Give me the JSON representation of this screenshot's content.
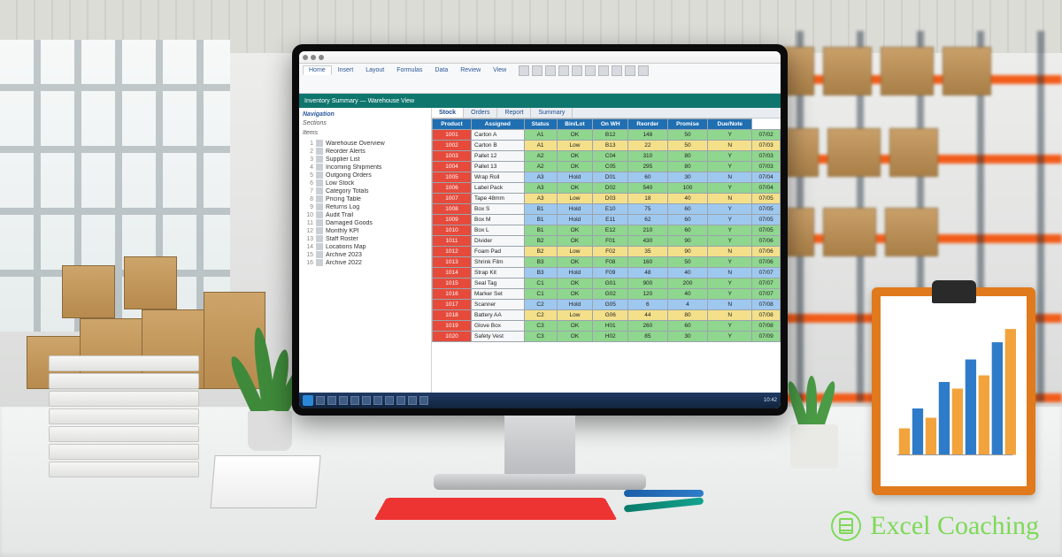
{
  "brand": {
    "name": "Excel Coaching"
  },
  "app": {
    "workband_title": "Inventory Summary — Warehouse View",
    "tabs": [
      {
        "label": "Home"
      },
      {
        "label": "Insert"
      },
      {
        "label": "Layout"
      },
      {
        "label": "Formulas"
      },
      {
        "label": "Data"
      },
      {
        "label": "Review"
      },
      {
        "label": "View"
      }
    ],
    "sheet_tabs": [
      {
        "label": "Stock"
      },
      {
        "label": "Orders"
      },
      {
        "label": "Report"
      },
      {
        "label": "Summary"
      }
    ]
  },
  "sidebar": {
    "header": "Navigation",
    "field_label": "Sections",
    "subheader": "Items",
    "items": [
      "Warehouse Overview",
      "Reorder Alerts",
      "Supplier List",
      "Incoming Shipments",
      "Outgoing Orders",
      "Low Stock",
      "Category Totals",
      "Pricing Table",
      "Returns Log",
      "Audit Trail",
      "Damaged Goods",
      "Monthly KPI",
      "Staff Roster",
      "Locations Map",
      "Archive 2023",
      "Archive 2022"
    ]
  },
  "table": {
    "headers": [
      "Product",
      "Assigned",
      "Status",
      "Bin/Lot",
      "On WH",
      "Reorder",
      "Promise",
      "Due/Note"
    ],
    "rows": [
      {
        "cls": "g",
        "id": "1001",
        "desc": "Carton A",
        "c": [
          "A1",
          "OK",
          "B12",
          "148",
          "50",
          "Y",
          "07/02"
        ]
      },
      {
        "cls": "y",
        "id": "1002",
        "desc": "Carton B",
        "c": [
          "A1",
          "Low",
          "B13",
          "22",
          "50",
          "N",
          "07/03"
        ]
      },
      {
        "cls": "g",
        "id": "1003",
        "desc": "Pallet 12",
        "c": [
          "A2",
          "OK",
          "C04",
          "310",
          "80",
          "Y",
          "07/03"
        ]
      },
      {
        "cls": "g",
        "id": "1004",
        "desc": "Pallet 13",
        "c": [
          "A2",
          "OK",
          "C05",
          "295",
          "80",
          "Y",
          "07/03"
        ]
      },
      {
        "cls": "b",
        "id": "1005",
        "desc": "Wrap Roll",
        "c": [
          "A3",
          "Hold",
          "D01",
          "60",
          "30",
          "N",
          "07/04"
        ]
      },
      {
        "cls": "g",
        "id": "1006",
        "desc": "Label Pack",
        "c": [
          "A3",
          "OK",
          "D02",
          "540",
          "100",
          "Y",
          "07/04"
        ]
      },
      {
        "cls": "y",
        "id": "1007",
        "desc": "Tape 48mm",
        "c": [
          "A3",
          "Low",
          "D03",
          "18",
          "40",
          "N",
          "07/05"
        ]
      },
      {
        "cls": "b",
        "id": "1008",
        "desc": "Box S",
        "c": [
          "B1",
          "Hold",
          "E10",
          "75",
          "60",
          "Y",
          "07/05"
        ]
      },
      {
        "cls": "b",
        "id": "1009",
        "desc": "Box M",
        "c": [
          "B1",
          "Hold",
          "E11",
          "62",
          "60",
          "Y",
          "07/05"
        ]
      },
      {
        "cls": "g",
        "id": "1010",
        "desc": "Box L",
        "c": [
          "B1",
          "OK",
          "E12",
          "210",
          "60",
          "Y",
          "07/05"
        ]
      },
      {
        "cls": "g",
        "id": "1011",
        "desc": "Divider",
        "c": [
          "B2",
          "OK",
          "F01",
          "430",
          "90",
          "Y",
          "07/06"
        ]
      },
      {
        "cls": "y",
        "id": "1012",
        "desc": "Foam Pad",
        "c": [
          "B2",
          "Low",
          "F02",
          "35",
          "90",
          "N",
          "07/06"
        ]
      },
      {
        "cls": "g",
        "id": "1013",
        "desc": "Shrink Film",
        "c": [
          "B3",
          "OK",
          "F08",
          "160",
          "50",
          "Y",
          "07/06"
        ]
      },
      {
        "cls": "b",
        "id": "1014",
        "desc": "Strap Kit",
        "c": [
          "B3",
          "Hold",
          "F09",
          "48",
          "40",
          "N",
          "07/07"
        ]
      },
      {
        "cls": "g",
        "id": "1015",
        "desc": "Seal Tag",
        "c": [
          "C1",
          "OK",
          "G01",
          "900",
          "200",
          "Y",
          "07/07"
        ]
      },
      {
        "cls": "g",
        "id": "1016",
        "desc": "Marker Set",
        "c": [
          "C1",
          "OK",
          "G02",
          "120",
          "40",
          "Y",
          "07/07"
        ]
      },
      {
        "cls": "b",
        "id": "1017",
        "desc": "Scanner",
        "c": [
          "C2",
          "Hold",
          "G05",
          "6",
          "4",
          "N",
          "07/08"
        ]
      },
      {
        "cls": "y",
        "id": "1018",
        "desc": "Battery AA",
        "c": [
          "C2",
          "Low",
          "G06",
          "44",
          "80",
          "N",
          "07/08"
        ]
      },
      {
        "cls": "g",
        "id": "1019",
        "desc": "Glove Box",
        "c": [
          "C3",
          "OK",
          "H01",
          "260",
          "60",
          "Y",
          "07/08"
        ]
      },
      {
        "cls": "g",
        "id": "1020",
        "desc": "Safety Vest",
        "c": [
          "C3",
          "OK",
          "H02",
          "85",
          "30",
          "Y",
          "07/09"
        ]
      }
    ]
  },
  "taskbar": {
    "clock": "10:42"
  },
  "chart_data": {
    "type": "bar",
    "title": "",
    "categories": [
      "1",
      "2",
      "3",
      "4",
      "5",
      "6",
      "7",
      "8",
      "9"
    ],
    "values": [
      20,
      35,
      28,
      55,
      50,
      72,
      60,
      85,
      95
    ],
    "ylim": [
      0,
      100
    ],
    "colors": [
      "#f2a33c",
      "#2e7cc9"
    ]
  }
}
